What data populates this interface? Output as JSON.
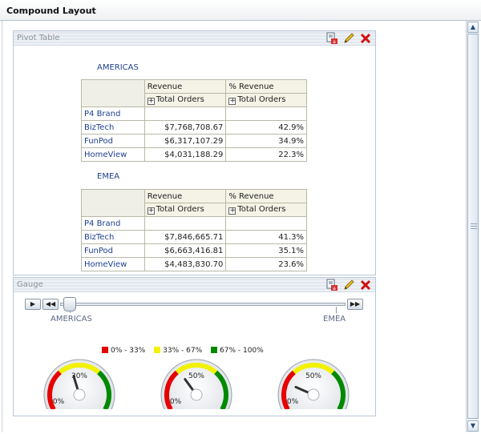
{
  "window": {
    "title": "Compound Layout"
  },
  "colors": {
    "low": "#e60000",
    "mid": "#f2f200",
    "high": "#008a00",
    "link": "#1d3f8f"
  },
  "pivot_panel": {
    "title": "Pivot Table",
    "tools": [
      "export-icon",
      "edit-icon",
      "delete-icon"
    ],
    "sections": [
      {
        "region": "AMERICAS",
        "measures": [
          "Revenue",
          "% Revenue"
        ],
        "sub_header": "Total Orders",
        "row_dim": "P4 Brand",
        "rows": [
          {
            "brand": "BizTech",
            "revenue": "$7,768,708.67",
            "pct": "42.9%"
          },
          {
            "brand": "FunPod",
            "revenue": "$6,317,107.29",
            "pct": "34.9%"
          },
          {
            "brand": "HomeView",
            "revenue": "$4,031,188.29",
            "pct": "22.3%"
          }
        ]
      },
      {
        "region": "EMEA",
        "measures": [
          "Revenue",
          "% Revenue"
        ],
        "sub_header": "Total Orders",
        "row_dim": "P4 Brand",
        "rows": [
          {
            "brand": "BizTech",
            "revenue": "$7,846,665.71",
            "pct": "41.3%"
          },
          {
            "brand": "FunPod",
            "revenue": "$6,663,416.81",
            "pct": "35.1%"
          },
          {
            "brand": "HomeView",
            "revenue": "$4,483,830.70",
            "pct": "23.6%"
          }
        ]
      }
    ]
  },
  "gauge_panel": {
    "title": "Gauge",
    "slider": {
      "labels": [
        "AMERICAS",
        "EMEA"
      ],
      "selected": "AMERICAS"
    },
    "legend": [
      {
        "label": "0% - 33%",
        "color": "#e60000"
      },
      {
        "label": "33% - 67%",
        "color": "#f2f200"
      },
      {
        "label": "67% - 100%",
        "color": "#008a00"
      }
    ],
    "gauges": [
      {
        "value": 42.9,
        "center_label": "30%",
        "min_label": "0%"
      },
      {
        "value": 34.9,
        "center_label": "50%",
        "min_label": "0%"
      },
      {
        "value": 22.3,
        "center_label": "50%",
        "min_label": "0%"
      }
    ]
  }
}
